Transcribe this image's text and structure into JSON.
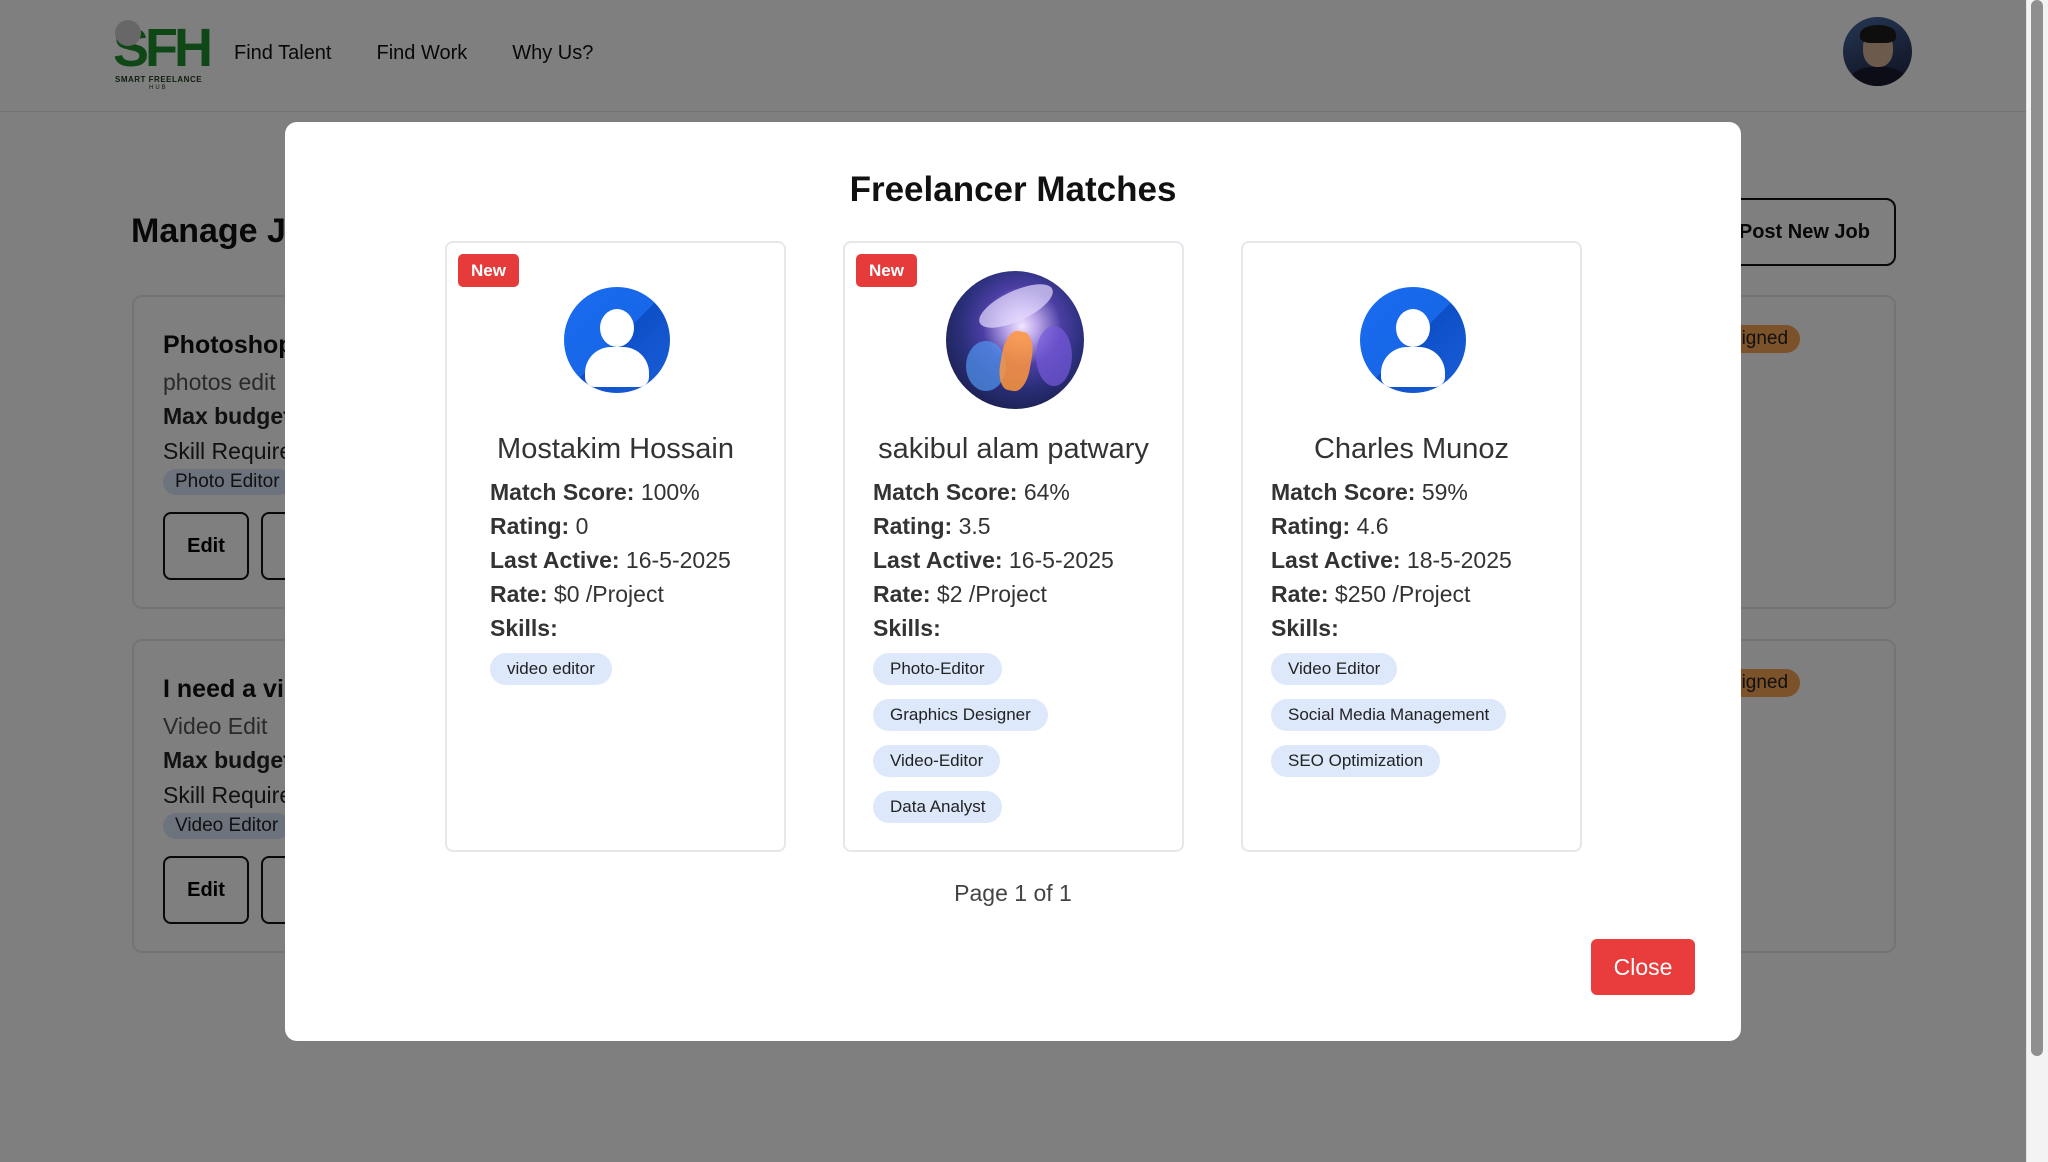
{
  "nav": {
    "logo_text": "SMART FREELANCE",
    "logo_sub": "HUB",
    "links": [
      "Find Talent",
      "Find Work",
      "Why Us?"
    ]
  },
  "page": {
    "title": "Manage J",
    "post_job_label": "Post New Job"
  },
  "jobs": [
    {
      "title": "Photoshop",
      "description": "photos edit",
      "budget_label": "Max budget",
      "skills_label": "Skill Require",
      "skill": "Photo Editor",
      "edit_label": "Edit",
      "status": "assigned"
    },
    {
      "title": "I need a vi",
      "description": "Video Edit",
      "budget_label": "Max budget",
      "skills_label": "Skill Require",
      "skill": "Video Editor",
      "edit_label": "Edit",
      "status": "assigned"
    }
  ],
  "modal": {
    "title": "Freelancer Matches",
    "pagination": "Page 1 of 1",
    "close_label": "Close",
    "labels": {
      "match_score": "Match Score:",
      "rating": "Rating:",
      "last_active": "Last Active:",
      "rate": "Rate:",
      "skills": "Skills:"
    },
    "freelancers": [
      {
        "badge": "New",
        "avatar": "default-user-icon",
        "name": "Mostakim Hossain",
        "match_score": "100%",
        "rating": "0",
        "last_active": "16-5-2025",
        "rate": "$0 /Project",
        "skills": [
          "video editor"
        ]
      },
      {
        "badge": "New",
        "avatar": "profile-photo",
        "name": "sakibul alam patwary",
        "match_score": "64%",
        "rating": "3.5",
        "last_active": "16-5-2025",
        "rate": "$2 /Project",
        "skills": [
          "Photo-Editor",
          "Graphics Designer",
          "Video-Editor",
          "Data Analyst"
        ]
      },
      {
        "badge": "",
        "avatar": "default-user-icon",
        "name": "Charles Munoz",
        "match_score": "59%",
        "rating": "4.6",
        "last_active": "18-5-2025",
        "rate": "$250 /Project",
        "skills": [
          "Video Editor",
          "Social Media Management",
          "SEO Optimization"
        ]
      }
    ]
  },
  "colors": {
    "accent_red": "#e63b3b",
    "brand_green": "#1f8f2f",
    "skill_chip_bg": "#dde8fb",
    "status_orange": "#f6a453"
  }
}
